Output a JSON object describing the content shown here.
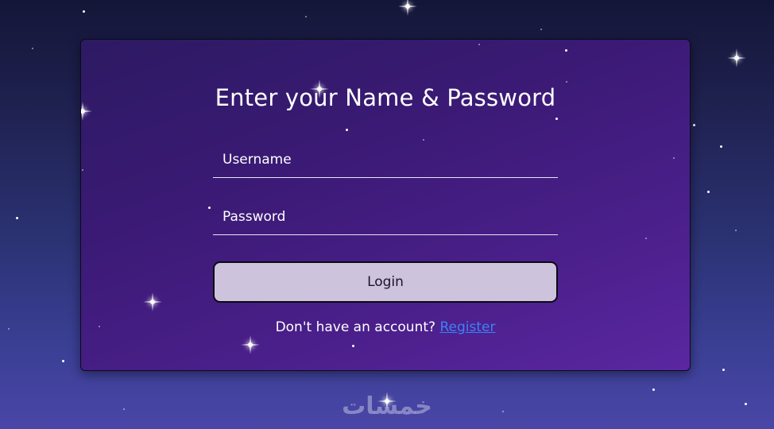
{
  "login_form": {
    "title": "Enter your Name & Password",
    "username_placeholder": "Username",
    "password_placeholder": "Password",
    "login_label": "Login",
    "register_prompt": "Don't have an account?",
    "register_link": "Register"
  },
  "watermark": {
    "text": "خمسات"
  },
  "colors": {
    "background_top": "#141638",
    "background_bottom": "#4a46a8",
    "card": "#3a1a74",
    "button": "#cdc3dc",
    "link": "#3b82f6"
  }
}
